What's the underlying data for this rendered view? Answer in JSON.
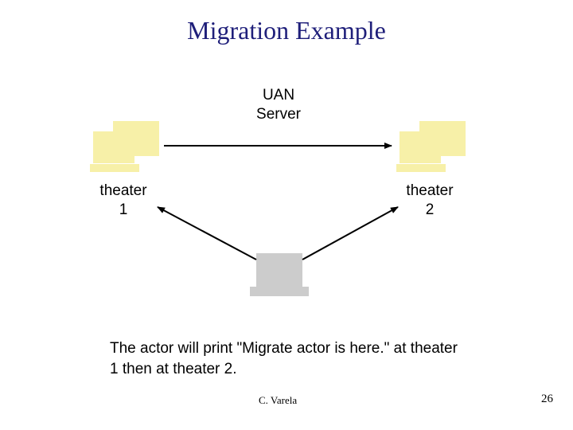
{
  "title": "Migration Example",
  "uan_label": "UAN\nServer",
  "theater1_label": "theater\n1",
  "theater2_label": "theater\n2",
  "caption": "The actor will print \"Migrate actor is here.\" at theater 1 then at theater 2.",
  "footer_author": "C. Varela",
  "footer_page": "26",
  "colors": {
    "workstation": "#f7f0a8",
    "actor": "#cccccc",
    "arrow": "#000000"
  }
}
